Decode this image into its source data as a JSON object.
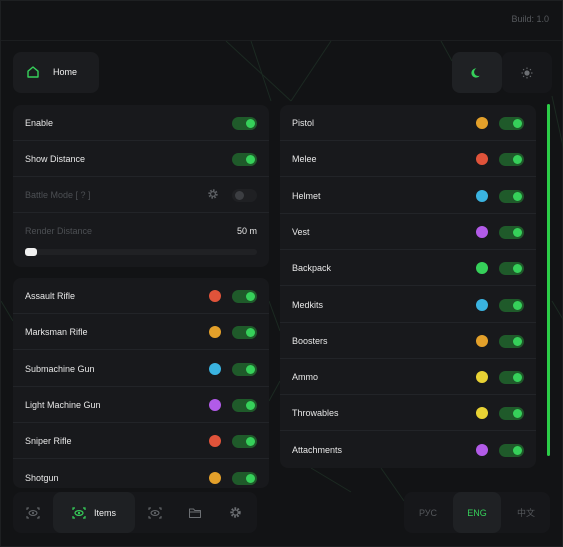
{
  "header": {
    "build": "Build: 1.0"
  },
  "home": {
    "label": "Home"
  },
  "colors": {
    "accent": "#36d05a",
    "panel": "#18191c",
    "background": "#121315"
  },
  "settings": {
    "enable": {
      "label": "Enable",
      "on": true
    },
    "show_distance": {
      "label": "Show Distance",
      "on": true
    },
    "battle_mode": {
      "label": "Battle Mode  [ ? ]",
      "on": false,
      "disabled": true
    },
    "render_distance": {
      "label": "Render Distance",
      "value": "50 m",
      "level": 0.05,
      "disabled": true
    }
  },
  "weapons": [
    {
      "label": "Assault Rifle",
      "color": "#e0533a",
      "on": true
    },
    {
      "label": "Marksman Rifle",
      "color": "#e3a02a",
      "on": true
    },
    {
      "label": "Submachine Gun",
      "color": "#3ab3e0",
      "on": true
    },
    {
      "label": "Light Machine Gun",
      "color": "#b25be8",
      "on": true
    },
    {
      "label": "Sniper Rifle",
      "color": "#e0533a",
      "on": true
    },
    {
      "label": "Shotgun",
      "color": "#e3a02a",
      "on": true
    }
  ],
  "items": [
    {
      "label": "Pistol",
      "color": "#e3a02a",
      "on": true
    },
    {
      "label": "Melee",
      "color": "#e0533a",
      "on": true
    },
    {
      "label": "Helmet",
      "color": "#3ab3e0",
      "on": true
    },
    {
      "label": "Vest",
      "color": "#b25be8",
      "on": true
    },
    {
      "label": "Backpack",
      "color": "#36d05a",
      "on": true
    },
    {
      "label": "Medkits",
      "color": "#3ab3e0",
      "on": true
    },
    {
      "label": "Boosters",
      "color": "#e3a02a",
      "on": true
    },
    {
      "label": "Ammo",
      "color": "#e8d234",
      "on": true
    },
    {
      "label": "Throwables",
      "color": "#e8d234",
      "on": true
    },
    {
      "label": "Attachments",
      "color": "#b25be8",
      "on": true
    }
  ],
  "nav": {
    "items_label": "Items",
    "icons": [
      "eye-icon",
      "eye-icon",
      "eye-icon",
      "folder-icon",
      "gear-icon"
    ]
  },
  "languages": [
    {
      "label": "РУС",
      "active": false
    },
    {
      "label": "ENG",
      "active": true
    },
    {
      "label": "中文",
      "active": false
    }
  ],
  "theme": {
    "icons": [
      "moon-icon",
      "sun-icon"
    ],
    "active": "moon-icon"
  }
}
